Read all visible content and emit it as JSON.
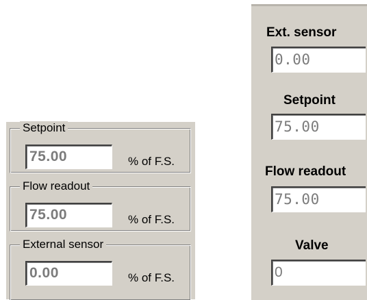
{
  "left_panel": {
    "groups": [
      {
        "legend": "Setpoint",
        "value": "75.00",
        "unit": "% of F.S."
      },
      {
        "legend": "Flow readout",
        "value": "75.00",
        "unit": "% of F.S."
      },
      {
        "legend": "External sensor",
        "value": "0.00",
        "unit": "% of F.S."
      }
    ]
  },
  "right_panel": {
    "ext_sensor": {
      "label": "Ext. sensor",
      "value": "0.00"
    },
    "setpoint": {
      "label": "Setpoint",
      "value": "75.00"
    },
    "flow_readout": {
      "label": "Flow readout",
      "value": "75.00"
    },
    "valve": {
      "label": "Valve",
      "value": "0"
    }
  }
}
